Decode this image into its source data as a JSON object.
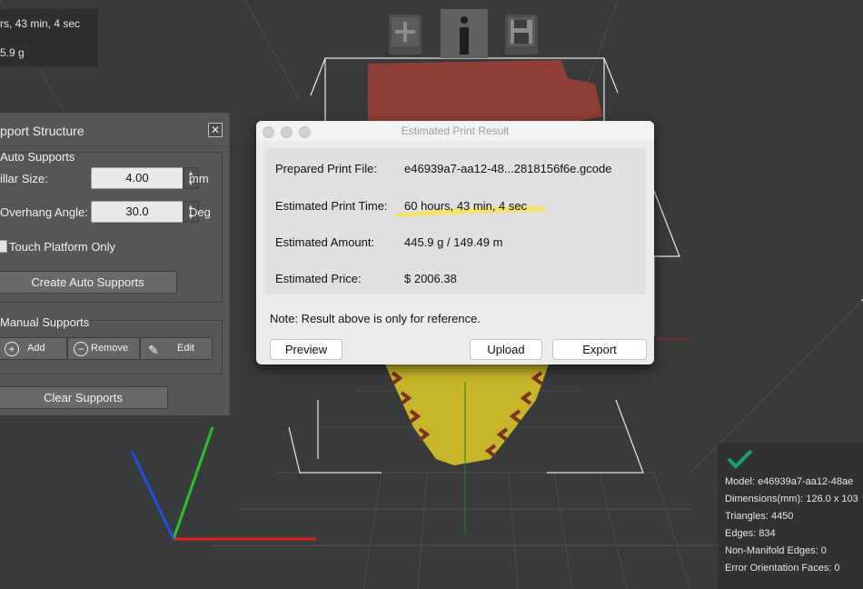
{
  "top_left_panel": {
    "time_fragment": "rs, 43 min, 4 sec",
    "weight_fragment": "5.9 g"
  },
  "toolbar": {
    "add_icon": "plus-icon",
    "info_icon": "info-icon",
    "save_icon": "save-icon"
  },
  "support_panel": {
    "title": "pport Structure",
    "close_label": "✕",
    "auto_group": "Auto Supports",
    "pillar_label": "illar Size:",
    "pillar_value": "4.00",
    "pillar_unit": "mm",
    "overhang_label": "Overhang Angle:",
    "overhang_value": "30.0",
    "overhang_unit": "Deg",
    "touch_platform_label": "Touch Platform Only",
    "create_button": "Create Auto Supports",
    "manual_group": "Manual Supports",
    "add_button": "Add",
    "remove_button": "Remove",
    "edit_button": "Edit",
    "clear_button": "Clear Supports"
  },
  "dialog": {
    "title": "Estimated Print Result",
    "rows": [
      {
        "label": "Prepared Print File:",
        "value": "e46939a7-aa12-48...2818156f6e.gcode"
      },
      {
        "label": "Estimated Print Time:",
        "value": "60 hours, 43 min, 4 sec"
      },
      {
        "label": "Estimated Amount:",
        "value": "445.9 g / 149.49 m"
      },
      {
        "label": "Estimated Price:",
        "value": "$ 2006.38"
      }
    ],
    "note": "Note: Result above is only for reference.",
    "preview_button": "Preview",
    "upload_button": "Upload",
    "export_button": "Export",
    "highlight_color": "#f2e35a"
  },
  "model_info": {
    "status_icon": "checkmark-icon",
    "status_color": "#16a06e",
    "model": "Model: e46939a7-aa12-48ae",
    "dimensions": "Dimensions(mm): 126.0 x 103",
    "triangles": "Triangles: 4450",
    "edges": "Edges: 834",
    "non_manifold": "Non-Manifold Edges: 0",
    "error_orientation": "Error Orientation Faces: 0"
  },
  "colors": {
    "model_top": "#8e3e36",
    "model_bottom": "#c8b62a",
    "axis_x": "#e02020",
    "axis_y": "#2bbf2b",
    "axis_z": "#2050e0"
  }
}
